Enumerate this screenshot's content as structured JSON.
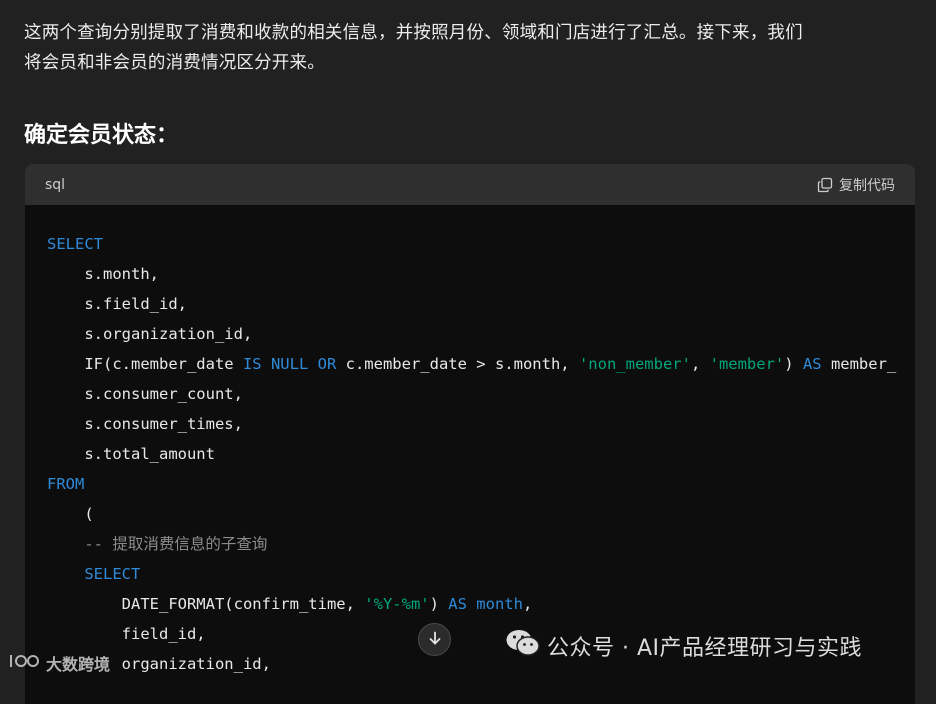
{
  "intro": {
    "line1": "这两个查询分别提取了消费和收款的相关信息，并按照月份、领域和门店进行了汇总。接下来，我们",
    "line2": "将会员和非会员的消费情况区分开来。"
  },
  "heading": "确定会员状态：",
  "code_block": {
    "language": "sql",
    "copy_label": "复制代码",
    "lines": [
      [
        {
          "t": "kw",
          "v": "SELECT"
        }
      ],
      [
        {
          "t": "p",
          "v": "    s.month,"
        }
      ],
      [
        {
          "t": "p",
          "v": "    s.field_id,"
        }
      ],
      [
        {
          "t": "p",
          "v": "    s.organization_id,"
        }
      ],
      [
        {
          "t": "p",
          "v": "    IF(c.member_date "
        },
        {
          "t": "kw",
          "v": "IS NULL"
        },
        {
          "t": "p",
          "v": " "
        },
        {
          "t": "kw",
          "v": "OR"
        },
        {
          "t": "p",
          "v": " c.member_date > s.month, "
        },
        {
          "t": "str",
          "v": "'non_member'"
        },
        {
          "t": "p",
          "v": ", "
        },
        {
          "t": "str",
          "v": "'member'"
        },
        {
          "t": "p",
          "v": ") "
        },
        {
          "t": "kw",
          "v": "AS"
        },
        {
          "t": "p",
          "v": " member_"
        }
      ],
      [
        {
          "t": "p",
          "v": "    s.consumer_count,"
        }
      ],
      [
        {
          "t": "p",
          "v": "    s.consumer_times,"
        }
      ],
      [
        {
          "t": "p",
          "v": "    s.total_amount"
        }
      ],
      [
        {
          "t": "kw",
          "v": "FROM"
        }
      ],
      [
        {
          "t": "p",
          "v": "    ("
        }
      ],
      [
        {
          "t": "cm",
          "v": "    -- 提取消费信息的子查询"
        }
      ],
      [
        {
          "t": "p",
          "v": "    "
        },
        {
          "t": "kw",
          "v": "SELECT"
        }
      ],
      [
        {
          "t": "p",
          "v": "        DATE_FORMAT(confirm_time, "
        },
        {
          "t": "str",
          "v": "'%Y-%m'"
        },
        {
          "t": "p",
          "v": ") "
        },
        {
          "t": "kw",
          "v": "AS"
        },
        {
          "t": "p",
          "v": " "
        },
        {
          "t": "kw",
          "v": "month"
        },
        {
          "t": "p",
          "v": ","
        }
      ],
      [
        {
          "t": "p",
          "v": "        field_id,"
        }
      ],
      [
        {
          "t": "p",
          "v": "        organization_id,"
        }
      ]
    ]
  },
  "watermark_right": "公众号 · AI产品经理研习与实践",
  "watermark_left": "大数跨境",
  "icons": {
    "copy": "copy-icon",
    "scroll": "arrow-down-icon",
    "wechat": "wechat-icon",
    "brand": "brand-logo-icon"
  },
  "colors": {
    "background": "#212121",
    "code_bg": "#0d0d0d",
    "keyword": "#2f8ad8",
    "string": "#00a67d",
    "comment": "#8c8c8c"
  }
}
